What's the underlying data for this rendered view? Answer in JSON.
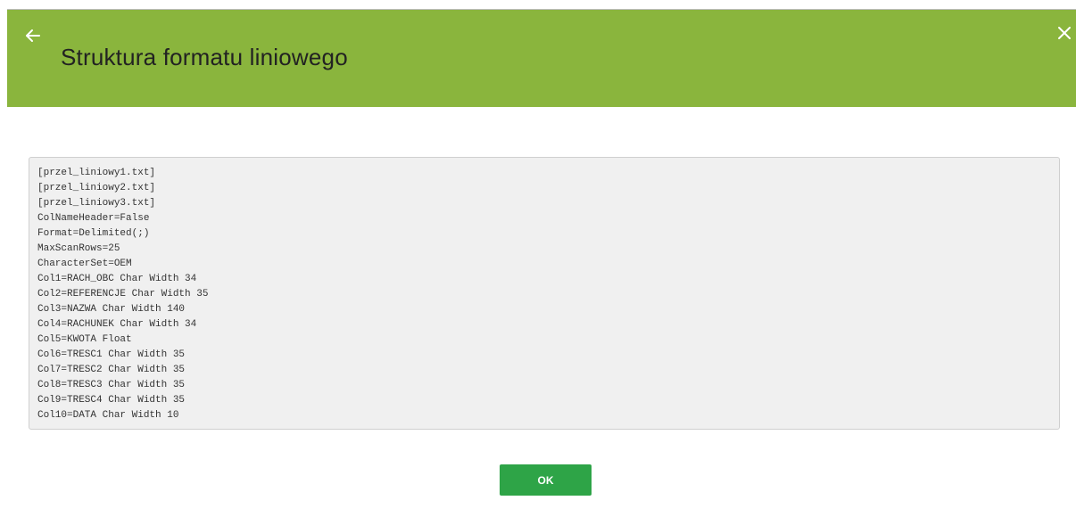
{
  "header": {
    "title": "Struktura formatu liniowego",
    "back_icon": "arrow-left-icon",
    "close_icon": "close-icon",
    "background_color": "#8ab53d"
  },
  "content": {
    "lines": [
      "[przel_liniowy1.txt]",
      "[przel_liniowy2.txt]",
      "[przel_liniowy3.txt]",
      "ColNameHeader=False",
      "Format=Delimited(;)",
      "MaxScanRows=25",
      "CharacterSet=OEM",
      "Col1=RACH_OBC Char Width 34",
      "Col2=REFERENCJE Char Width 35",
      "Col3=NAZWA Char Width 140",
      "Col4=RACHUNEK Char Width 34",
      "Col5=KWOTA Float",
      "Col6=TRESC1 Char Width 35",
      "Col7=TRESC2 Char Width 35",
      "Col8=TRESC3 Char Width 35",
      "Col9=TRESC4 Char Width 35",
      "Col10=DATA Char Width 10"
    ]
  },
  "footer": {
    "ok_label": "OK",
    "ok_color": "#2ea447"
  }
}
